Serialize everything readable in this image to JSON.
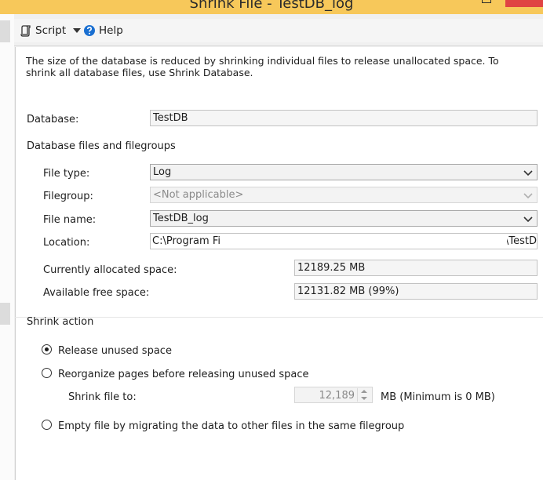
{
  "window": {
    "title": "Shrink File - TestDB_log"
  },
  "toolbar": {
    "script_label": "Script",
    "help_label": "Help"
  },
  "description": "The size of the database is reduced by shrinking individual files to release unallocated space. To shrink all database files, use Shrink Database.",
  "database": {
    "label": "Database:",
    "value": "TestDB"
  },
  "files_section": {
    "title": "Database files and filegroups"
  },
  "file_type": {
    "label": "File type:",
    "value": "Log"
  },
  "filegroup": {
    "label": "Filegroup:",
    "value": "<Not applicable>"
  },
  "file_name": {
    "label": "File name:",
    "value": "TestDB_log"
  },
  "location": {
    "label": "Location:",
    "value_start": "C:\\Program File",
    "value_end": "\\TestD"
  },
  "allocated": {
    "label": "Currently allocated space:",
    "value": "12189.25 MB"
  },
  "free": {
    "label": "Available free space:",
    "value": "12131.82 MB (99%)"
  },
  "shrink_action": {
    "title": "Shrink action",
    "release_label": "Release unused space",
    "reorganize_label": "Reorganize pages before releasing unused space",
    "shrink_to_label": "Shrink file to:",
    "shrink_to_value": "12,189",
    "shrink_to_unit": "MB (Minimum is 0 MB)",
    "empty_label": "Empty file by migrating the data to other files in the same filegroup",
    "selected": "release"
  },
  "colors": {
    "title_bar": "#f7c85a",
    "close_button": "#e04343",
    "help_icon": "#1a6fd1"
  }
}
